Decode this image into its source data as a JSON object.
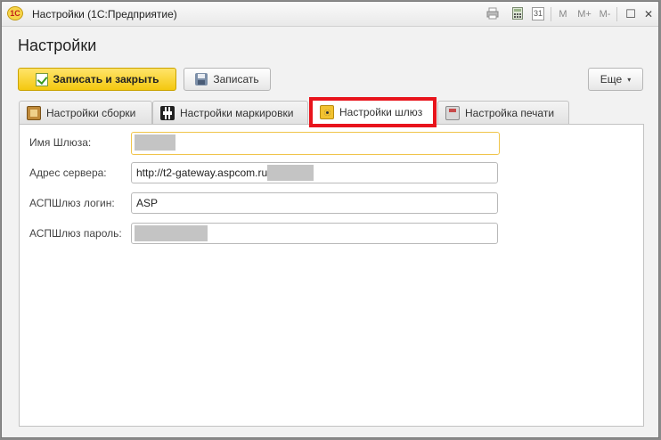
{
  "window": {
    "title": "Настройки  (1С:Предприятие)",
    "logo_text": "1С",
    "toolbar": {
      "icons": [
        "print-icon",
        "calculator-icon",
        "calendar-icon"
      ],
      "calendar_day": "31",
      "memory_labels": [
        "M",
        "M+",
        "M-"
      ],
      "minimize_symbol": "—",
      "maximize_symbol": "☐",
      "close_symbol": "✕"
    }
  },
  "form": {
    "title": "Настройки",
    "buttons": {
      "save_and_close": "Записать и закрыть",
      "save": "Записать",
      "more": "Еще",
      "more_caret": "▾"
    },
    "tabs": [
      {
        "label": "Настройки сборки",
        "icon": "box-icon"
      },
      {
        "label": "Настройки маркировки",
        "icon": "qr-code-icon"
      },
      {
        "label": "Настройки шлюз",
        "icon": "folder-gear-icon",
        "active": true
      },
      {
        "label": "Настройка печати",
        "icon": "printer-icon"
      }
    ],
    "highlight_color": "#e8141c",
    "fields": [
      {
        "label": "Имя Шлюза:",
        "value": "",
        "redacted": true
      },
      {
        "label": "Адрес сервера:",
        "value": "http://t2-gateway.aspcom.ru",
        "redacted_suffix": true
      },
      {
        "label": "АСПШлюз логин:",
        "value": "ASP"
      },
      {
        "label": "АСПШлюз пароль:",
        "value": "",
        "redacted": true
      }
    ]
  },
  "colors": {
    "primary_button": "#f4c80f",
    "focused_field_border": "#f0c44a"
  }
}
